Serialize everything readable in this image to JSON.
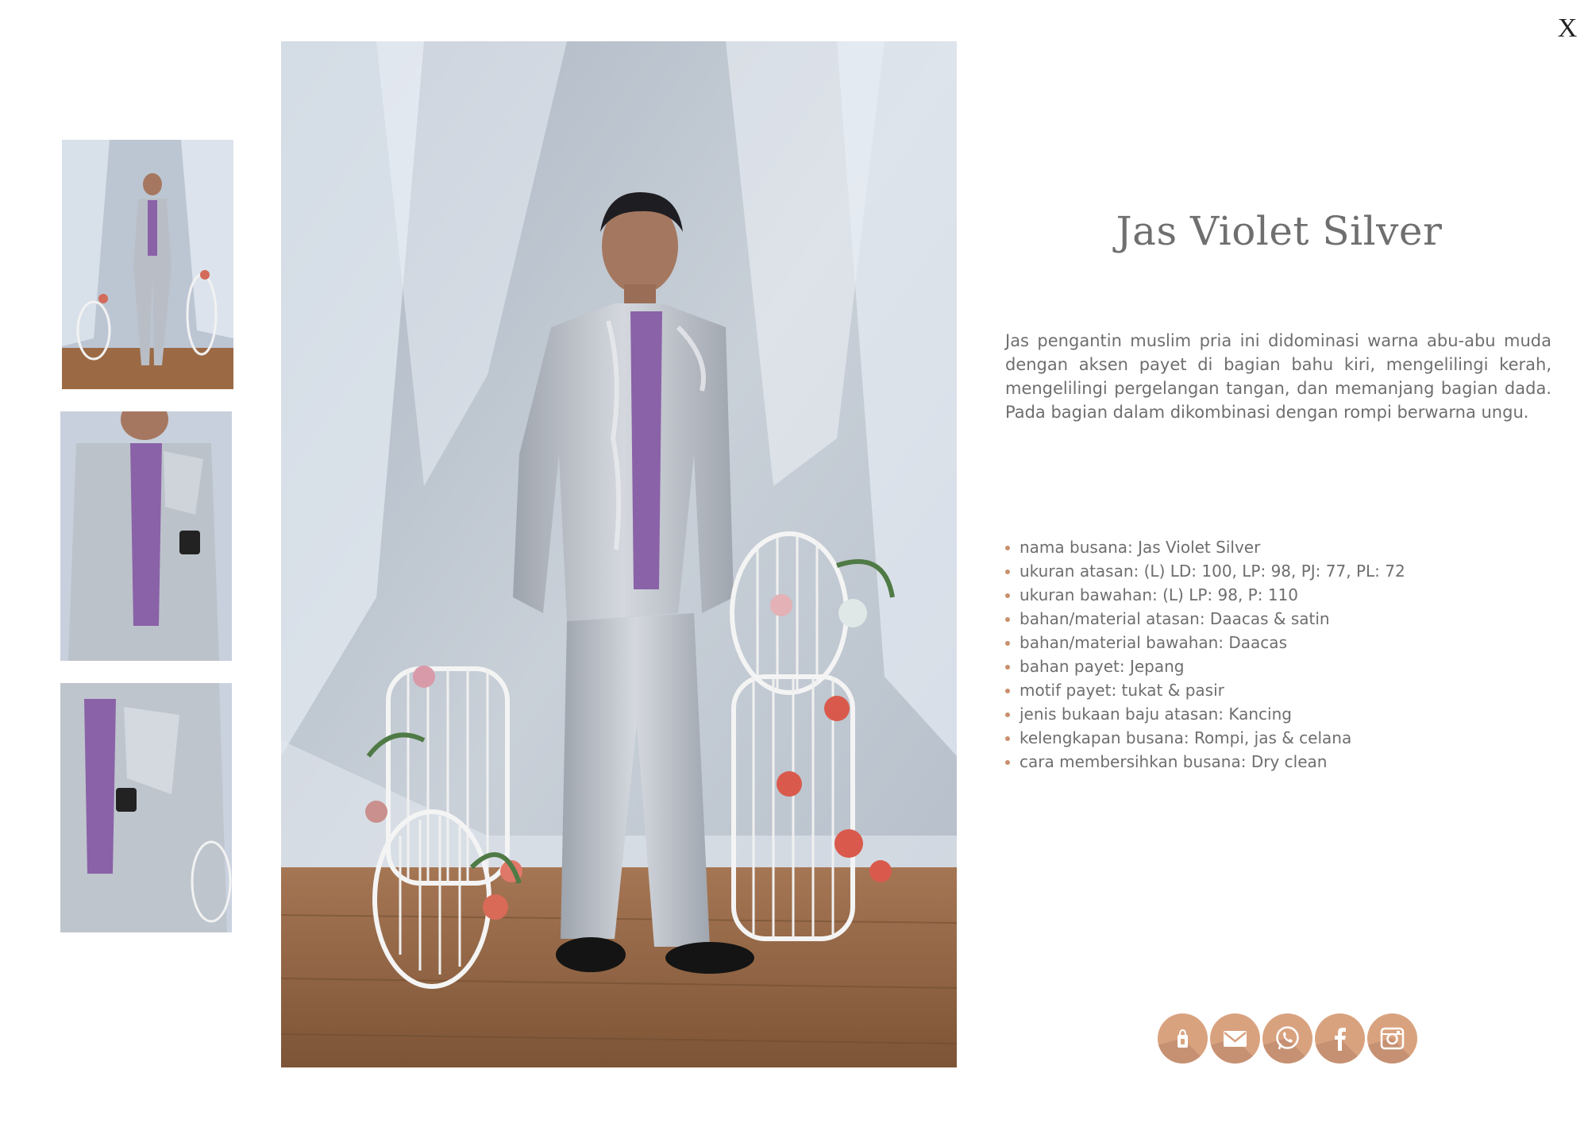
{
  "close_label": "X",
  "product": {
    "title": "Jas Violet Silver",
    "description": "Jas pengantin muslim pria ini didominasi warna abu-abu muda dengan aksen payet di bagian bahu kiri, mengelilingi kerah, mengelilingi pergelangan tangan, dan memanjang bagian dada. Pada bagian dalam dikombinasi dengan rompi berwarna ungu.",
    "specs": [
      "nama busana: Jas Violet Silver",
      "ukuran atasan: (L) LD: 100, LP: 98, PJ: 77, PL: 72",
      "ukuran bawahan: (L) LP: 98, P: 110",
      "bahan/material atasan: Daacas & satin",
      "bahan/material bawahan: Daacas",
      "bahan payet: Jepang",
      "motif payet: tukat & pasir",
      "jenis bukaan baju atasan: Kancing",
      "kelengkapan busana: Rompi, jas & celana",
      "cara membersihkan busana: Dry clean"
    ]
  },
  "social_icons": [
    "shopping-bag-icon",
    "email-icon",
    "whatsapp-icon",
    "facebook-icon",
    "instagram-icon"
  ],
  "colors": {
    "accent": "#d9a27f",
    "bullet": "#c98f6d",
    "text": "#6e6e6e",
    "jacket": "#b9bec6",
    "shirt": "#8a62a8"
  }
}
